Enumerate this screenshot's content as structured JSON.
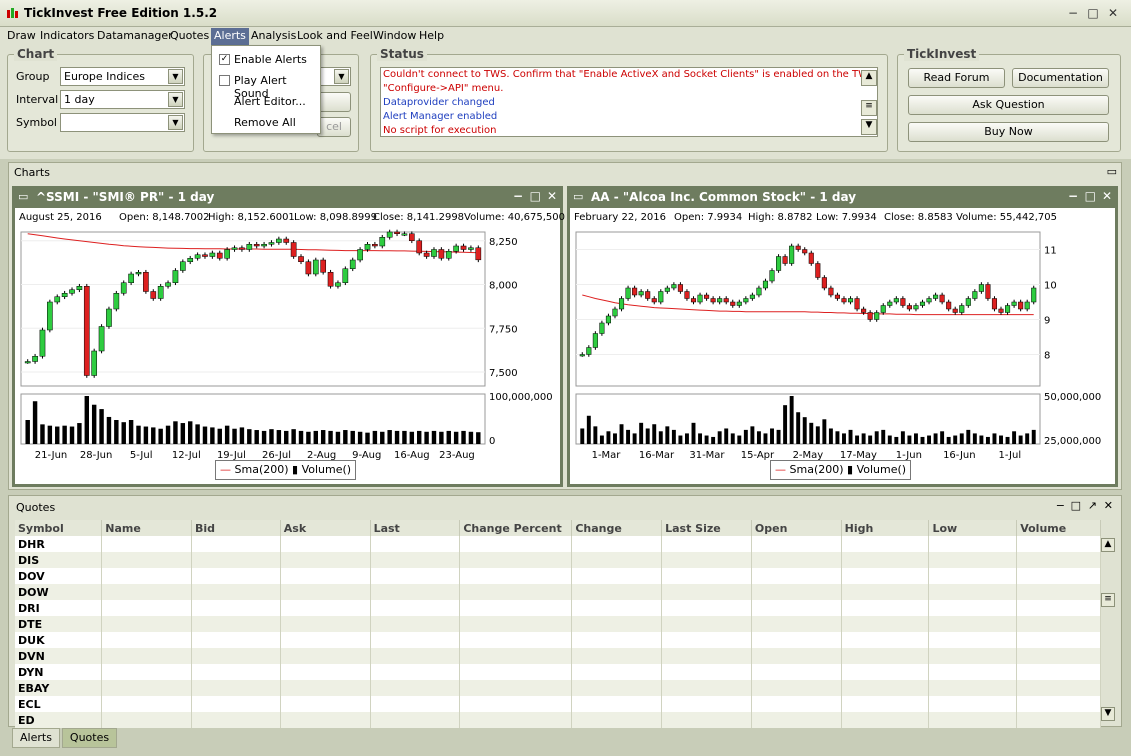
{
  "window": {
    "title": "TickInvest Free Edition 1.5.2"
  },
  "menu": [
    "Draw",
    "Indicators",
    "Datamanager",
    "Quotes",
    "Alerts",
    "Analysis",
    "Look and Feel",
    "Window",
    "Help"
  ],
  "alerts_menu": {
    "enable_alerts": "Enable Alerts",
    "enable_checked": true,
    "play_sound": "Play Alert Sound",
    "editor": "Alert Editor...",
    "remove_all": "Remove All"
  },
  "chart_panel": {
    "title": "Chart",
    "group_label": "Group",
    "group_value": "Europe Indices",
    "interval_label": "Interval",
    "interval_value": "1 day",
    "symbol_label": "Symbol",
    "symbol_value": "",
    "hidden_button_fragment": "cel"
  },
  "status_panel": {
    "title": "Status",
    "lines": [
      {
        "text": "Couldn't connect to TWS.  Confirm that \"Enable ActiveX and Socket Clients\" is enabled on the TWS",
        "color": "#cc0000"
      },
      {
        "text": "\"Configure->API\" menu.",
        "color": "#cc0000"
      },
      {
        "text": "Dataprovider changed",
        "color": "#1f3fbf"
      },
      {
        "text": "Alert Manager enabled",
        "color": "#1f3fbf"
      },
      {
        "text": "No script for execution",
        "color": "#cc0000"
      }
    ]
  },
  "tickinvest_panel": {
    "title": "TickInvest",
    "read_forum": "Read Forum",
    "documentation": "Documentation",
    "ask_question": "Ask Question",
    "buy_now": "Buy Now"
  },
  "charts_frame": {
    "title": "Charts"
  },
  "chart_data": [
    {
      "type": "candlestick",
      "title": "^SSMI - \"SMI® PR\" - 1 day",
      "info": {
        "date": "August 25, 2016",
        "open": "Open: 8,148.7002",
        "high": "High: 8,152.6001",
        "low": "Low: 8,098.8999",
        "close": "Close: 8,141.2998",
        "volume": "Volume: 40,675,500"
      },
      "y_ticks": [
        "8,250",
        "8,000",
        "7,750",
        "7,500"
      ],
      "y_tick_values": [
        8250,
        8000,
        7750,
        7500
      ],
      "ylim": [
        7420,
        8300
      ],
      "volume_ticks": [
        "100,000,000",
        "0"
      ],
      "x_ticks": [
        "21-Jun",
        "28-Jun",
        "5-Jul",
        "12-Jul",
        "19-Jul",
        "26-Jul",
        "2-Aug",
        "9-Aug",
        "16-Aug",
        "23-Aug"
      ],
      "closes": [
        7560,
        7590,
        7740,
        7900,
        7930,
        7950,
        7970,
        7990,
        7480,
        7620,
        7760,
        7860,
        7950,
        8010,
        8060,
        8070,
        7960,
        7920,
        7990,
        8010,
        8080,
        8130,
        8150,
        8170,
        8160,
        8180,
        8150,
        8200,
        8210,
        8200,
        8230,
        8220,
        8230,
        8240,
        8260,
        8240,
        8160,
        8130,
        8060,
        8140,
        8070,
        7990,
        8010,
        8090,
        8140,
        8200,
        8230,
        8220,
        8270,
        8300,
        8290,
        8290,
        8250,
        8180,
        8160,
        8200,
        8150,
        8190,
        8220,
        8200,
        8210,
        8141
      ],
      "sma": [
        8290,
        8284,
        8278,
        8272,
        8266,
        8260,
        8255,
        8250,
        8245,
        8240,
        8235,
        8230,
        8226,
        8222,
        8219,
        8216,
        8214,
        8212,
        8210,
        8208,
        8207,
        8206,
        8205,
        8205,
        8204,
        8204,
        8204,
        8203,
        8203,
        8203,
        8203,
        8203,
        8202,
        8202,
        8202,
        8202,
        8201,
        8200,
        8199,
        8198,
        8197,
        8196,
        8195,
        8194,
        8194,
        8194,
        8194,
        8194,
        8193,
        8193,
        8192,
        8192,
        8191,
        8190,
        8189,
        8188,
        8187,
        8186,
        8185,
        8184,
        8183,
        8182
      ],
      "volumes": [
        55,
        98,
        45,
        42,
        40,
        42,
        40,
        48,
        110,
        90,
        80,
        62,
        55,
        50,
        55,
        42,
        40,
        38,
        35,
        42,
        52,
        48,
        52,
        45,
        40,
        38,
        35,
        42,
        35,
        38,
        34,
        32,
        30,
        34,
        32,
        30,
        34,
        30,
        28,
        30,
        32,
        30,
        28,
        32,
        30,
        28,
        26,
        30,
        28,
        32,
        30,
        30,
        28,
        30,
        28,
        30,
        28,
        30,
        28,
        30,
        28,
        27
      ],
      "volume_max": 110,
      "legend": [
        "Sma(200)",
        "Volume()"
      ]
    },
    {
      "type": "candlestick",
      "title": "AA - \"Alcoa Inc. Common Stock\" - 1 day",
      "info": {
        "date": "February 22, 2016",
        "open": "Open: 7.9934",
        "high": "High: 8.8782",
        "low": "Low: 7.9934",
        "close": "Close: 8.8583",
        "volume": "Volume: 55,442,705"
      },
      "y_ticks": [
        "11",
        "10",
        "9",
        "8"
      ],
      "y_tick_values": [
        11,
        10,
        9,
        8
      ],
      "ylim": [
        7.1,
        11.5
      ],
      "volume_ticks": [
        "50,000,000",
        "25,000,000"
      ],
      "x_ticks": [
        "1-Mar",
        "16-Mar",
        "31-Mar",
        "15-Apr",
        "2-May",
        "17-May",
        "1-Jun",
        "16-Jun",
        "1-Jul"
      ],
      "closes": [
        8.0,
        8.2,
        8.6,
        8.9,
        9.1,
        9.3,
        9.6,
        9.9,
        9.7,
        9.8,
        9.6,
        9.5,
        9.8,
        9.9,
        10.0,
        9.8,
        9.6,
        9.5,
        9.7,
        9.6,
        9.5,
        9.6,
        9.5,
        9.4,
        9.5,
        9.6,
        9.7,
        9.9,
        10.1,
        10.4,
        10.8,
        10.6,
        11.1,
        11.0,
        10.9,
        10.6,
        10.2,
        9.9,
        9.7,
        9.6,
        9.5,
        9.6,
        9.3,
        9.2,
        9.0,
        9.2,
        9.4,
        9.5,
        9.6,
        9.4,
        9.3,
        9.4,
        9.5,
        9.6,
        9.7,
        9.5,
        9.3,
        9.2,
        9.4,
        9.6,
        9.8,
        10.0,
        9.6,
        9.3,
        9.2,
        9.4,
        9.5,
        9.3,
        9.5,
        9.9
      ],
      "sma": [
        9.7,
        9.65,
        9.6,
        9.56,
        9.52,
        9.48,
        9.45,
        9.42,
        9.4,
        9.38,
        9.36,
        9.34,
        9.33,
        9.32,
        9.31,
        9.3,
        9.29,
        9.28,
        9.27,
        9.26,
        9.25,
        9.24,
        9.24,
        9.23,
        9.23,
        9.22,
        9.22,
        9.22,
        9.22,
        9.22,
        9.22,
        9.22,
        9.22,
        9.22,
        9.22,
        9.21,
        9.21,
        9.2,
        9.2,
        9.19,
        9.19,
        9.18,
        9.18,
        9.17,
        9.17,
        9.16,
        9.16,
        9.16,
        9.15,
        9.15,
        9.15,
        9.14,
        9.14,
        9.14,
        9.14,
        9.14,
        9.14,
        9.14,
        9.14,
        9.14,
        9.14,
        9.14,
        9.14,
        9.14,
        9.14,
        9.14,
        9.14,
        9.14,
        9.14,
        9.14
      ],
      "volumes": [
        22,
        40,
        25,
        12,
        18,
        15,
        28,
        20,
        15,
        30,
        22,
        28,
        18,
        25,
        20,
        12,
        15,
        30,
        15,
        12,
        10,
        18,
        22,
        15,
        12,
        20,
        25,
        18,
        15,
        22,
        20,
        55,
        68,
        45,
        38,
        30,
        25,
        35,
        22,
        18,
        15,
        20,
        12,
        15,
        12,
        18,
        20,
        12,
        10,
        18,
        12,
        15,
        10,
        12,
        15,
        18,
        10,
        12,
        15,
        20,
        15,
        12,
        10,
        15,
        12,
        10,
        18,
        12,
        15,
        20
      ],
      "volume_max": 68,
      "legend": [
        "Sma(200)",
        "Volume()"
      ]
    }
  ],
  "quotes": {
    "title": "Quotes",
    "columns": [
      "Symbol",
      "Name",
      "Bid",
      "Ask",
      "Last",
      "Change Percent",
      "Change",
      "Last Size",
      "Open",
      "High",
      "Low",
      "Volume"
    ],
    "rows": [
      "DHR",
      "DIS",
      "DOV",
      "DOW",
      "DRI",
      "DTE",
      "DUK",
      "DVN",
      "DYN",
      "EBAY",
      "ECL",
      "ED"
    ]
  },
  "tabs": [
    "Alerts",
    "Quotes"
  ],
  "colors": {
    "up": "#2ecc40",
    "down": "#dd2020",
    "sma": "#dd2020",
    "accent": "#5c6e94"
  }
}
